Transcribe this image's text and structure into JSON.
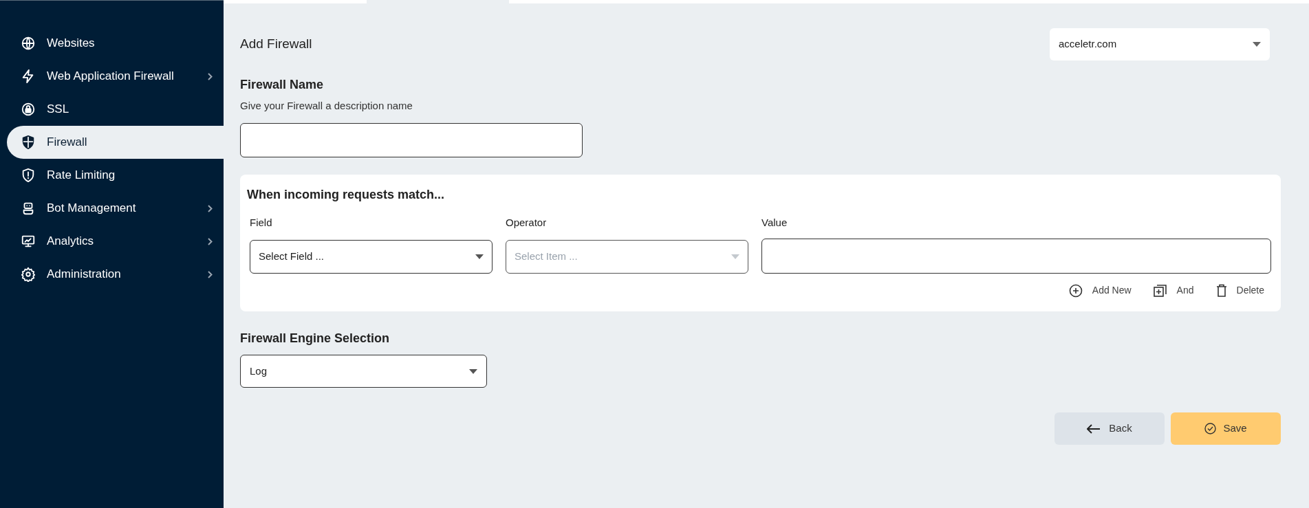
{
  "sidebar": {
    "items": [
      {
        "label": "Websites",
        "selected": false,
        "has_submenu": false
      },
      {
        "label": "Web Application Firewall",
        "selected": false,
        "has_submenu": true
      },
      {
        "label": "SSL",
        "selected": false,
        "has_submenu": false
      },
      {
        "label": "Firewall",
        "selected": true,
        "has_submenu": false
      },
      {
        "label": "Rate Limiting",
        "selected": false,
        "has_submenu": false
      },
      {
        "label": "Bot Management",
        "selected": false,
        "has_submenu": true
      },
      {
        "label": "Analytics",
        "selected": false,
        "has_submenu": true
      },
      {
        "label": "Administration",
        "selected": false,
        "has_submenu": true
      }
    ]
  },
  "page_title": "Add Firewall",
  "domain_select": {
    "value": "acceletr.com"
  },
  "firewall_name": {
    "label": "Firewall Name",
    "hint": "Give your Firewall a description name"
  },
  "match_panel": {
    "title": "When incoming requests match...",
    "columns": [
      {
        "label": "Field",
        "kind": "select",
        "value": "Select Field ...",
        "disabled": false
      },
      {
        "label": "Operator",
        "kind": "select",
        "value": "Select Item ...",
        "disabled": true
      },
      {
        "label": "Value",
        "kind": "text",
        "disabled": false
      }
    ],
    "actions": [
      {
        "label": "Add New",
        "kind": "add"
      },
      {
        "label": "And",
        "kind": "and"
      },
      {
        "label": "Delete",
        "kind": "delete"
      }
    ]
  },
  "engine": {
    "label": "Firewall Engine Selection",
    "value": "Log"
  },
  "buttons": [
    {
      "label": "Back",
      "kind": "back"
    },
    {
      "label": "Save",
      "kind": "save"
    }
  ]
}
